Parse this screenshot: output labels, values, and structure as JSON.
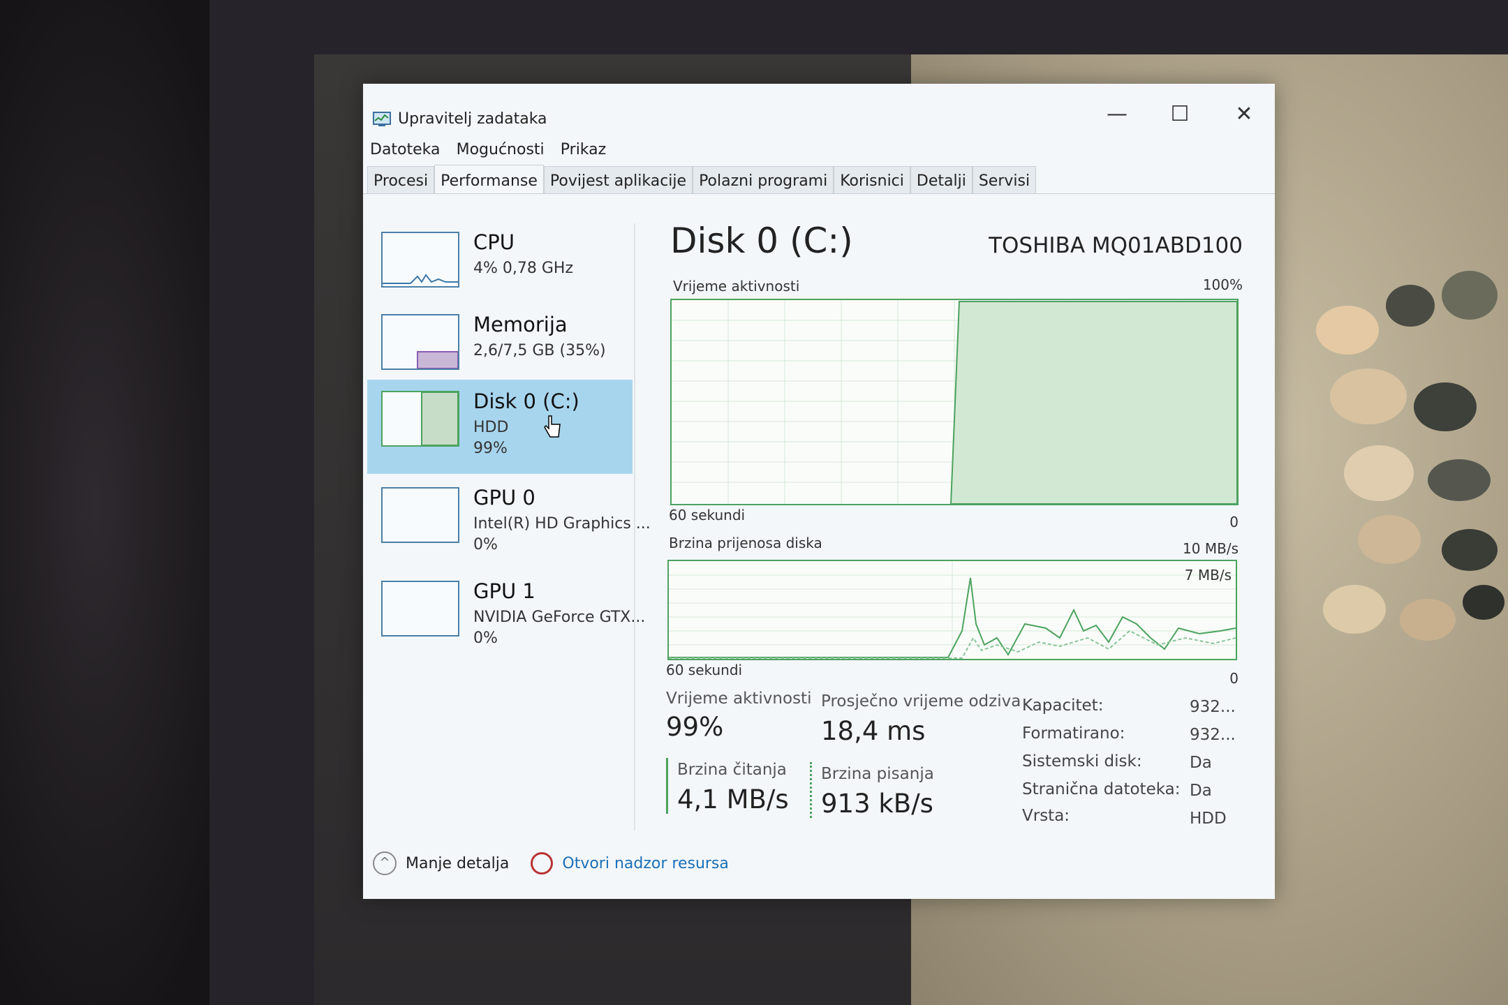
{
  "window": {
    "title": "Upravitelj zadataka",
    "minimize_glyph": "—",
    "maximize_glyph": "☐",
    "close_glyph": "✕"
  },
  "menu": [
    "Datoteka",
    "Mogućnosti",
    "Prikaz"
  ],
  "tabs": [
    "Procesi",
    "Performanse",
    "Povijest aplikacije",
    "Polazni programi",
    "Korisnici",
    "Detalji",
    "Servisi"
  ],
  "active_tab": "Performanse",
  "sidebar": [
    {
      "title": "CPU",
      "sub": "4% 0,78 GHz",
      "val": ""
    },
    {
      "title": "Memorija",
      "sub": "2,6/7,5 GB (35%)",
      "val": ""
    },
    {
      "title": "Disk 0 (C:)",
      "sub": "HDD",
      "val": "99%"
    },
    {
      "title": "GPU 0",
      "sub": "Intel(R) HD Graphics ...",
      "val": "0%"
    },
    {
      "title": "GPU 1",
      "sub": "NVIDIA GeForce GTX...",
      "val": "0%"
    }
  ],
  "main": {
    "title": "Disk 0 (C:)",
    "model": "TOSHIBA MQ01ABD100",
    "graph1": {
      "label": "Vrijeme aktivnosti",
      "max": "100%",
      "time": "60 sekundi",
      "min": "0"
    },
    "graph2": {
      "label": "Brzina prijenosa diska",
      "max": "10 MB/s",
      "inner": "7 MB/s",
      "time": "60 sekundi",
      "min": "0"
    },
    "stats": {
      "active_label": "Vrijeme aktivnosti",
      "active_value": "99%",
      "response_label": "Prosječno vrijeme odziva",
      "response_value": "18,4 ms",
      "read_label": "Brzina čitanja",
      "read_value": "4,1 MB/s",
      "write_label": "Brzina pisanja",
      "write_value": "913 kB/s"
    },
    "props": [
      {
        "k": "Kapacitet:",
        "v": "932..."
      },
      {
        "k": "Formatirano:",
        "v": "932..."
      },
      {
        "k": "Sistemski disk:",
        "v": "Da"
      },
      {
        "k": "Stranična datoteka:",
        "v": "Da"
      },
      {
        "k": "Vrsta:",
        "v": "HDD"
      }
    ]
  },
  "footer": {
    "less": "Manje detalja",
    "open": "Otvori nadzor resursa"
  }
}
